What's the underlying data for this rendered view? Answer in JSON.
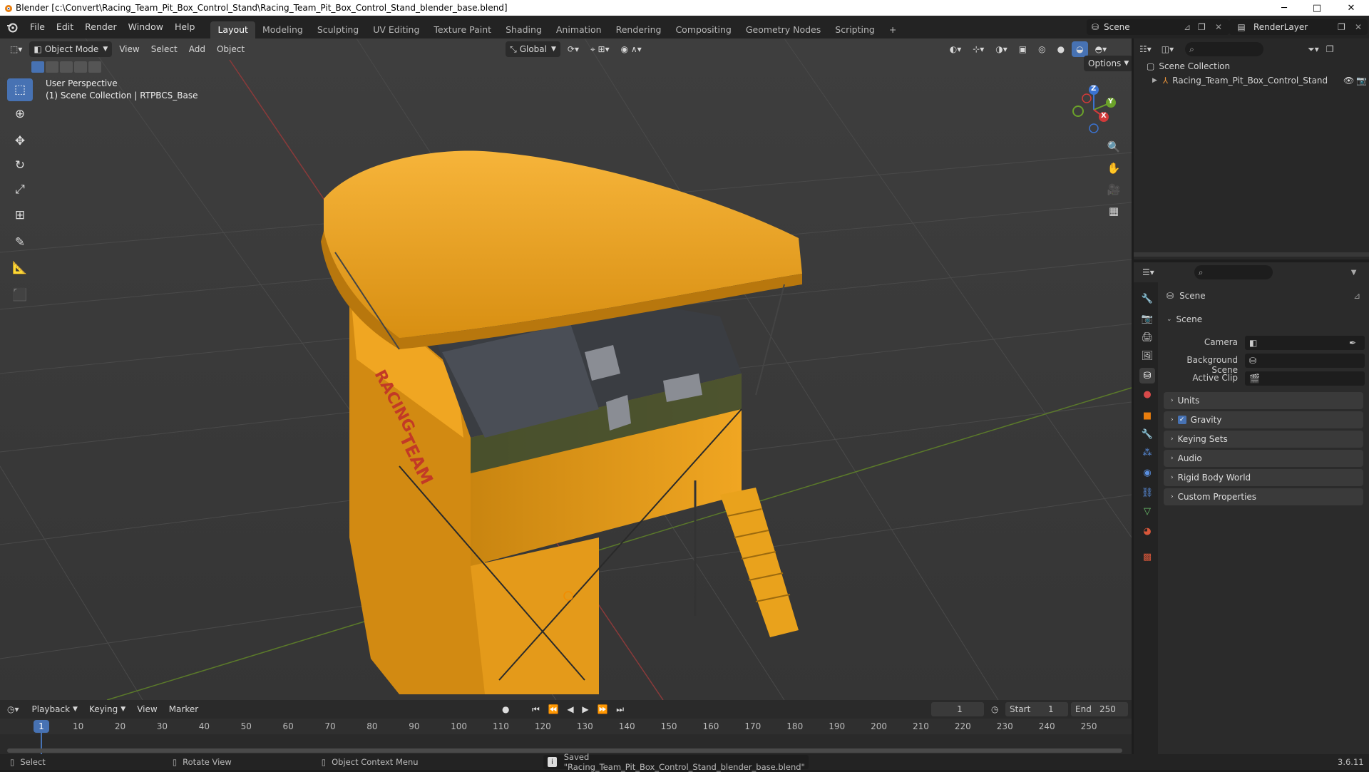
{
  "window": {
    "title": "Blender [c:\\Convert\\Racing_Team_Pit_Box_Control_Stand\\Racing_Team_Pit_Box_Control_Stand_blender_base.blend]",
    "minimize": "─",
    "maximize": "□",
    "close": "✕"
  },
  "menu": {
    "file": "File",
    "edit": "Edit",
    "render": "Render",
    "window": "Window",
    "help": "Help"
  },
  "workspaces": [
    "Layout",
    "Modeling",
    "Sculpting",
    "UV Editing",
    "Texture Paint",
    "Shading",
    "Animation",
    "Rendering",
    "Compositing",
    "Geometry Nodes",
    "Scripting"
  ],
  "workspace_add": "+",
  "scene_selector": {
    "value": "Scene"
  },
  "renderlayer_selector": {
    "value": "RenderLayer"
  },
  "viewport_header": {
    "mode": "Object Mode",
    "view": "View",
    "select": "Select",
    "add": "Add",
    "object": "Object",
    "orientation": "Global",
    "options": "Options"
  },
  "viewport": {
    "perspective": "User Perspective",
    "collection_info": "(1) Scene Collection | RTPBCS_Base"
  },
  "gizmo": {
    "x": "X",
    "y": "Y",
    "z": "Z"
  },
  "outliner": {
    "root": "Scene Collection",
    "items": [
      {
        "label": "Racing_Team_Pit_Box_Control_Stand"
      }
    ]
  },
  "properties": {
    "context": "Scene",
    "panel_title": "Scene",
    "camera_label": "Camera",
    "background_scene_label": "Background Scene",
    "active_clip_label": "Active Clip",
    "sections": [
      "Units",
      "Gravity",
      "Keying Sets",
      "Audio",
      "Rigid Body World",
      "Custom Properties"
    ],
    "gravity_checked": true
  },
  "timeline": {
    "playback": "Playback",
    "keying": "Keying",
    "view": "View",
    "marker": "Marker",
    "current_frame": "1",
    "start_label": "Start",
    "start": "1",
    "end_label": "End",
    "end": "250",
    "ticks": [
      "1",
      "10",
      "20",
      "30",
      "40",
      "50",
      "60",
      "70",
      "80",
      "90",
      "100",
      "110",
      "120",
      "130",
      "140",
      "150",
      "160",
      "170",
      "180",
      "190",
      "200",
      "210",
      "220",
      "230",
      "240",
      "250"
    ]
  },
  "statusbar": {
    "select": "Select",
    "rotate": "Rotate View",
    "context_menu": "Object Context Menu",
    "message": "Saved \"Racing_Team_Pit_Box_Control_Stand_blender_base.blend\"",
    "version": "3.6.11"
  },
  "model": {
    "side_text_1": "RACING",
    "side_text_2": "TEAM"
  },
  "colors": {
    "accent": "#4772b3",
    "model_yellow": "#f2a81c",
    "grid_red": "#8a3a3a",
    "grid_green": "#5b7a2a"
  }
}
